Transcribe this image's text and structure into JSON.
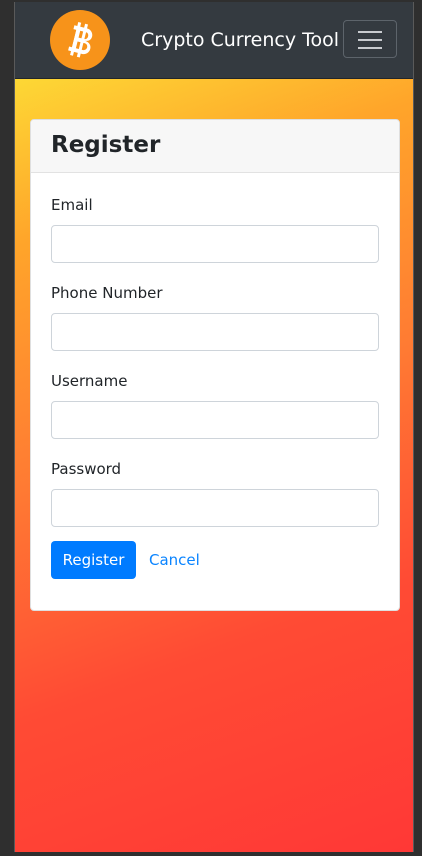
{
  "navbar": {
    "brand_title": "Crypto Currency Tool",
    "logo_icon": "bitcoin-icon",
    "logo_color": "#f7931a",
    "menu_icon": "hamburger-menu-icon",
    "background": "#343a40"
  },
  "form": {
    "title": "Register",
    "fields": [
      {
        "label": "Email",
        "value": "",
        "placeholder": ""
      },
      {
        "label": "Phone Number",
        "value": "",
        "placeholder": ""
      },
      {
        "label": "Username",
        "value": "",
        "placeholder": ""
      },
      {
        "label": "Password",
        "value": "",
        "placeholder": ""
      }
    ],
    "submit_label": "Register",
    "cancel_label": "Cancel"
  },
  "colors": {
    "primary": "#007bff",
    "gradient_start": "#fdd835",
    "gradient_end": "#ff3836"
  }
}
